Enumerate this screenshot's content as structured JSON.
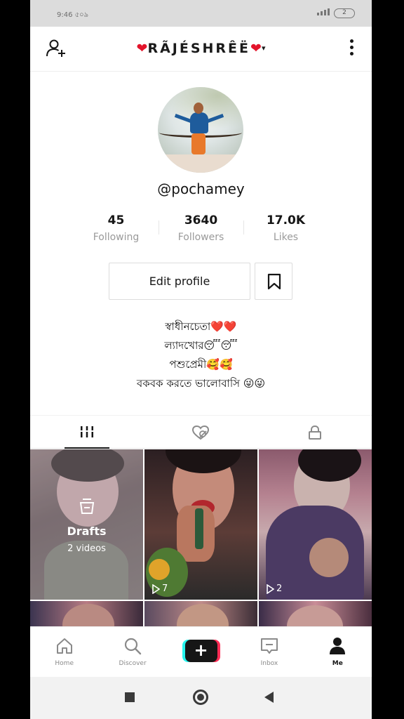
{
  "status_bar": {
    "time": "9:46 ৫০৯",
    "battery": "2"
  },
  "header": {
    "heart_left": "❤",
    "name": "RÃJÉSHRÊË",
    "heart_right": "❤",
    "caret": "▾"
  },
  "profile": {
    "username": "@pochamey",
    "stats": [
      {
        "value": "45",
        "label": "Following"
      },
      {
        "value": "3640",
        "label": "Followers"
      },
      {
        "value": "17.0K",
        "label": "Likes"
      }
    ],
    "edit_label": "Edit profile",
    "bio": [
      "স্বাধীনচেতা❤️❤️",
      "ল্যাদখোর😴😴",
      "পশুপ্রেমী🥰🥰",
      "বকবক করতে ভালোবাসি 😜😜"
    ]
  },
  "tabs": [
    {
      "name": "videos",
      "icon": "grid-icon",
      "active": true
    },
    {
      "name": "liked",
      "icon": "heart-hidden-icon",
      "active": false
    },
    {
      "name": "private",
      "icon": "lock-icon",
      "active": false
    }
  ],
  "videos": {
    "drafts_label": "Drafts",
    "drafts_count": "2 videos",
    "items": [
      {
        "views": "7"
      },
      {
        "views": "2"
      }
    ]
  },
  "bottom_nav": [
    {
      "label": "Home",
      "icon": "home-icon"
    },
    {
      "label": "Discover",
      "icon": "search-icon"
    },
    {
      "label": "",
      "icon": "plus-icon"
    },
    {
      "label": "Inbox",
      "icon": "inbox-icon"
    },
    {
      "label": "Me",
      "icon": "person-icon"
    }
  ],
  "colors": {
    "heart": "#e3142b",
    "text": "#161616",
    "muted": "#9a9a9a",
    "accent_cyan": "#25f4ee",
    "accent_pink": "#fe2c55"
  }
}
